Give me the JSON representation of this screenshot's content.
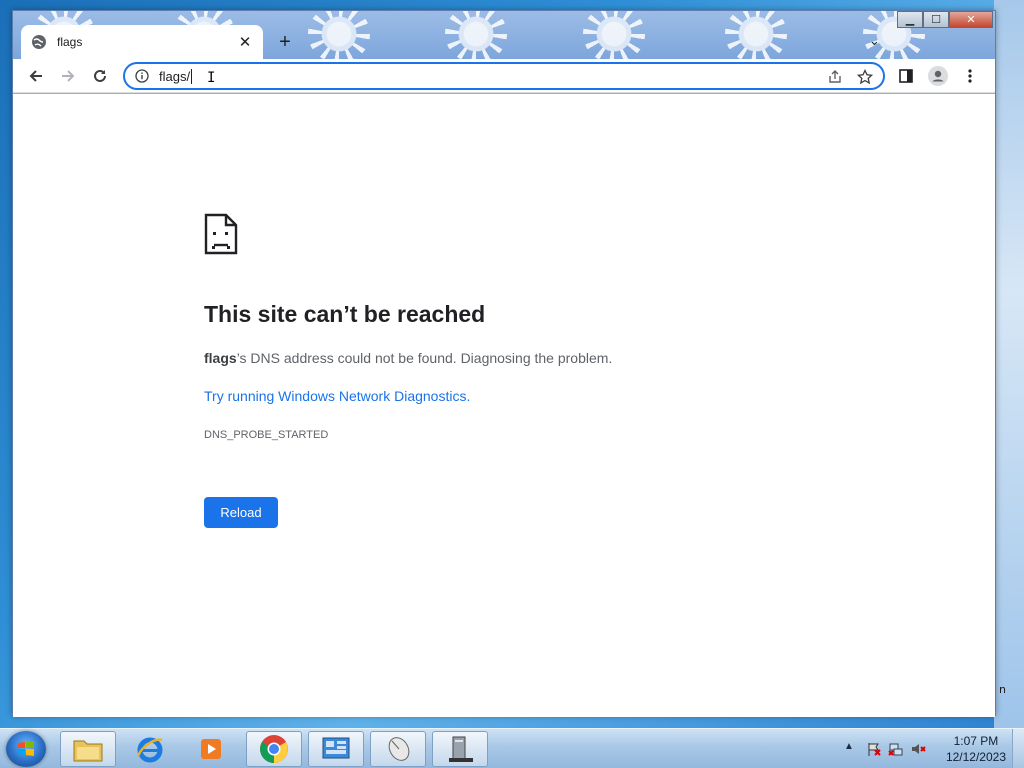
{
  "desktop": {
    "edge_text": "n"
  },
  "window": {
    "controls": {
      "minimize": "▁",
      "maximize": "☐",
      "close": "✕"
    }
  },
  "tab": {
    "title": "flags",
    "close": "✕"
  },
  "tabstrip": {
    "new_tab": "+",
    "tab_search": "⌄"
  },
  "toolbar": {
    "back_icon": "arrow-left",
    "forward_icon": "arrow-right",
    "reload_icon": "reload"
  },
  "omnibox": {
    "value": "flags/",
    "icon": "info-circle"
  },
  "error_page": {
    "title": "This site can’t be reached",
    "host": "flags",
    "desc_rest": "’s DNS address could not be found. Diagnosing the problem.",
    "link": "Try running Windows Network Diagnostics.",
    "code": "DNS_PROBE_STARTED",
    "reload_label": "Reload"
  },
  "taskbar": {
    "apps": [
      "file-explorer",
      "internet-explorer",
      "media-player",
      "chrome",
      "control-panel",
      "mouse-settings",
      "device-manager"
    ],
    "clock": {
      "time": "1:07 PM",
      "date": "12/12/2023"
    }
  },
  "colors": {
    "accent": "#1a73e8",
    "title_text": "#202124",
    "body_text": "#5f6368"
  }
}
